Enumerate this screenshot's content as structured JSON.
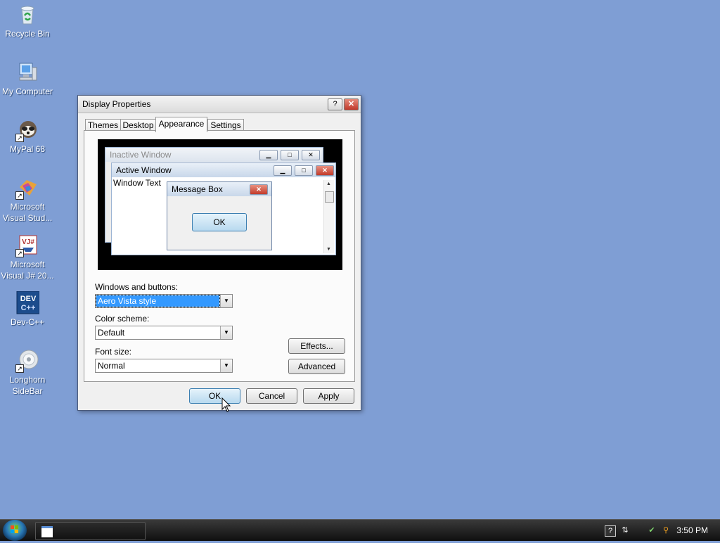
{
  "desktop": {
    "icons": [
      {
        "label": "Recycle Bin",
        "icon": "recycle-bin-icon"
      },
      {
        "label": "My Computer",
        "icon": "computer-icon"
      },
      {
        "label": "MyPal 68",
        "icon": "mypal-icon"
      },
      {
        "label": "Microsoft\nVisual Stud...",
        "icon": "visual-studio-icon"
      },
      {
        "label": "Microsoft\nVisual J# 20...",
        "icon": "visual-jsharp-icon"
      },
      {
        "label": "Dev-C++",
        "icon": "devcpp-icon"
      },
      {
        "label": "Longhorn\nSideBar",
        "icon": "sidebar-icon"
      }
    ]
  },
  "dialog": {
    "title": "Display Properties",
    "help_glyph": "?",
    "close_glyph": "✕",
    "tabs": [
      "Themes",
      "Desktop",
      "Appearance",
      "Settings"
    ],
    "active_tab": "Appearance",
    "preview": {
      "inactive_title": "Inactive Window",
      "active_title": "Active Window",
      "window_text": "Window Text",
      "message_box_title": "Message Box",
      "message_box_ok": "OK"
    },
    "windows_buttons_label": "Windows and buttons:",
    "windows_buttons_value": "Aero Vista style",
    "color_scheme_label": "Color scheme:",
    "color_scheme_value": "Default",
    "font_size_label": "Font size:",
    "font_size_value": "Normal",
    "effects_button": "Effects...",
    "advanced_button": "Advanced",
    "ok_button": "OK",
    "cancel_button": "Cancel",
    "apply_button": "Apply"
  },
  "taskbar": {
    "clock": "3:50 PM"
  },
  "colors": {
    "desktop": "#7f9ed4",
    "selection": "#3399ff",
    "taskbar": "#1a1a1a"
  }
}
